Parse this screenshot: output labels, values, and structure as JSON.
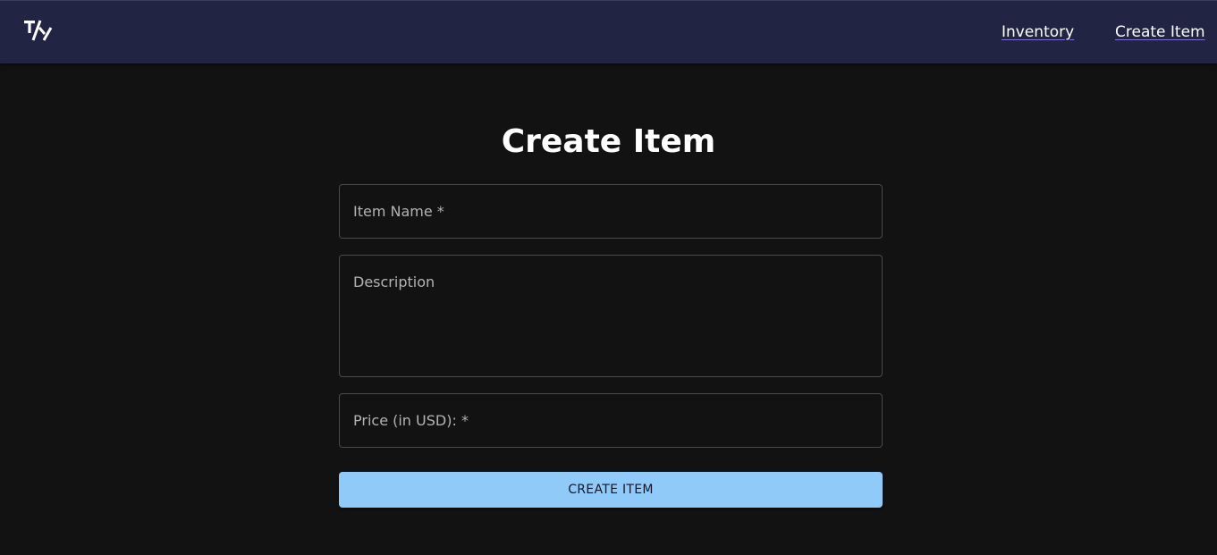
{
  "navbar": {
    "logo_text": "T/Y",
    "links": {
      "inventory": "Inventory",
      "create_item": "Create Item"
    }
  },
  "form": {
    "title": "Create Item",
    "item_name": {
      "placeholder": "Item Name *",
      "value": ""
    },
    "description": {
      "placeholder": "Description",
      "value": ""
    },
    "price": {
      "placeholder": "Price (in USD): *",
      "value": ""
    },
    "submit_label": "CREATE ITEM"
  },
  "colors": {
    "navbar_bg": "#212442",
    "page_bg": "#121212",
    "button_bg": "#90caf9",
    "link_underline": "#7b6fd0"
  }
}
